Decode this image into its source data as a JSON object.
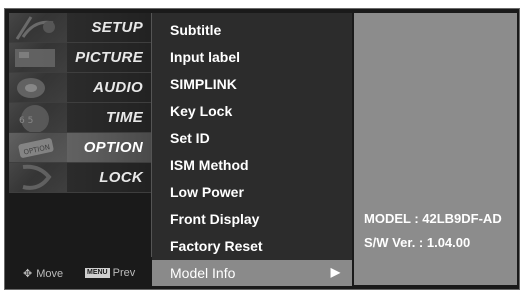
{
  "categories": [
    {
      "label": "SETUP",
      "icon": "satellite-dish-icon",
      "selected": false
    },
    {
      "label": "PICTURE",
      "icon": "picture-icon",
      "selected": false
    },
    {
      "label": "AUDIO",
      "icon": "speaker-icon",
      "selected": false
    },
    {
      "label": "TIME",
      "icon": "clock-icon",
      "selected": false
    },
    {
      "label": "OPTION",
      "icon": "option-tag-icon",
      "selected": true
    },
    {
      "label": "LOCK",
      "icon": "lock-icon",
      "selected": false
    }
  ],
  "help": {
    "move_label": "Move",
    "menu_chip": "MENU",
    "prev_label": "Prev"
  },
  "options": [
    {
      "label": "Subtitle"
    },
    {
      "label": "Input label"
    },
    {
      "label": "SIMPLINK"
    },
    {
      "label": "Key Lock"
    },
    {
      "label": "Set ID"
    },
    {
      "label": "ISM Method"
    },
    {
      "label": "Low Power"
    },
    {
      "label": "Front Display"
    },
    {
      "label": "Factory Reset"
    },
    {
      "label": "Model Info",
      "selected": true,
      "arrow": "▶"
    }
  ],
  "info": {
    "model_line": "MODEL : 42LB9DF-AD",
    "sw_line": "S/W Ver. : 1.04.00"
  },
  "colors": {
    "selected_row": "#8a8a8a",
    "panel_bg": "#8c8c8c",
    "list_bg": "#2c2c2c"
  }
}
